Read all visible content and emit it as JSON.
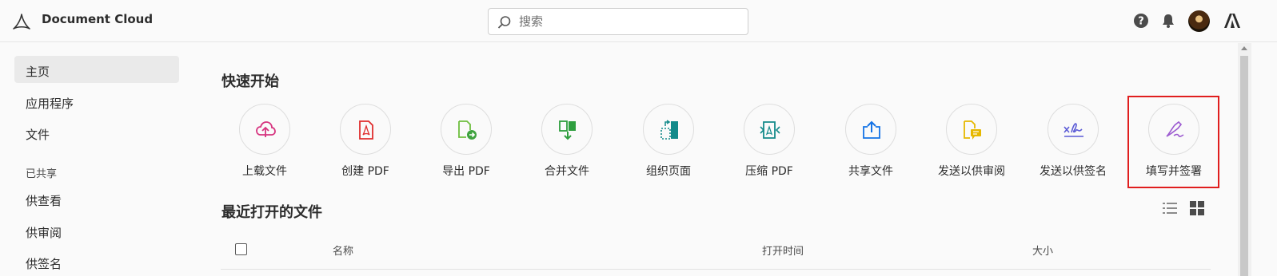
{
  "header": {
    "app_title": "Document Cloud",
    "search_placeholder": "搜索",
    "icons": [
      "adobe-acrobat-logo-icon",
      "search-icon",
      "help-icon",
      "bell-icon",
      "avatar",
      "adobe-logo-icon"
    ]
  },
  "sidebar": {
    "items": [
      {
        "label": "主页",
        "active": true
      },
      {
        "label": "应用程序"
      },
      {
        "label": "文件"
      }
    ],
    "shared_section": "已共享",
    "shared_items": [
      {
        "label": "供查看"
      },
      {
        "label": "供审阅"
      },
      {
        "label": "供签名"
      }
    ]
  },
  "quick_start": {
    "title": "快速开始",
    "tools": [
      {
        "label": "上载文件",
        "icon": "upload-cloud-icon",
        "color": "#d6337f"
      },
      {
        "label": "创建 PDF",
        "icon": "create-pdf-icon",
        "color": "#e02e2e"
      },
      {
        "label": "导出 PDF",
        "icon": "export-pdf-icon",
        "color": "#6fbf3f"
      },
      {
        "label": "合并文件",
        "icon": "combine-files-icon",
        "color": "#2e9e3e"
      },
      {
        "label": "组织页面",
        "icon": "organize-pages-icon",
        "color": "#138a8a"
      },
      {
        "label": "压缩 PDF",
        "icon": "compress-pdf-icon",
        "color": "#138a8a"
      },
      {
        "label": "共享文件",
        "icon": "share-file-icon",
        "color": "#1473e6"
      },
      {
        "label": "发送以供审阅",
        "icon": "send-for-review-icon",
        "color": "#e6b800"
      },
      {
        "label": "发送以供签名",
        "icon": "send-for-signature-icon",
        "color": "#5b5bd6"
      },
      {
        "label": "填写并签署",
        "icon": "fill-and-sign-icon",
        "color": "#9b59d0"
      }
    ]
  },
  "recent": {
    "title": "最近打开的文件",
    "columns": [
      "名称",
      "打开时间",
      "大小"
    ],
    "view_icons": [
      "list-view-icon",
      "grid-view-icon"
    ]
  },
  "colors": {
    "highlight": "#e01e1e",
    "background": "#fafafa"
  }
}
